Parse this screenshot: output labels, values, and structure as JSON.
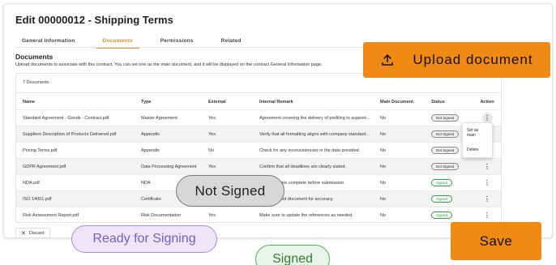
{
  "page": {
    "title": "Edit 00000012 - Shipping Terms",
    "tabs": [
      "General Information",
      "Documents",
      "Permissions",
      "Related"
    ],
    "active_tab": "Documents"
  },
  "documents": {
    "heading": "Documents",
    "description": "Upload documents to associate with this contract. You can set one as the main document, and it will be displayed on the contract General Information page.",
    "count_label": "7 Documents",
    "columns": [
      "Name",
      "Type",
      "External",
      "Internal Remark",
      "Main Document",
      "Status",
      "Action"
    ],
    "rows": [
      {
        "name": "Standard Agreement - Goods - Contract.pdf",
        "type": "Master Agreement",
        "external": "Yes",
        "remark": "Agreement covering the delivery of profiling to support...",
        "main": "No",
        "status": "Not Signed"
      },
      {
        "name": "Suppliers Description of Products Delivered.pdf",
        "type": "Appendix",
        "external": "Yes",
        "remark": "Verify that all formatting aligns with company standard...",
        "main": "No",
        "status": "Not Signed"
      },
      {
        "name": "Pricing Terms.pdf",
        "type": "Appendix",
        "external": "No",
        "remark": "Check for any inconsistencies in the data provided.",
        "main": "No",
        "status": "Not Signed"
      },
      {
        "name": "GDPR Agreement.pdf",
        "type": "Data Processing Agreement",
        "external": "Yes",
        "remark": "Confirm that all deadlines are clearly stated.",
        "main": "No",
        "status": "Not Signed"
      },
      {
        "name": "NDA.pdf",
        "type": "NDA",
        "external": "",
        "remark": "...sections are complete before submission.",
        "main": "No",
        "status": "Signed"
      },
      {
        "name": "ISO 14001.pdf",
        "type": "Certificate",
        "external": "",
        "remark": "...he attached document for accuracy.",
        "main": "No",
        "status": "Signed"
      },
      {
        "name": "Risk Assessment Report.pdf",
        "type": "Risk Documentation",
        "external": "Yes",
        "remark": "Make sure to update the references as needed.",
        "main": "No",
        "status": "Signed"
      }
    ]
  },
  "action_menu": {
    "set_main": "Set as main",
    "delete": "Delete"
  },
  "discard_label": "Discard",
  "upload_label": "Upload document",
  "save_label": "Save",
  "callouts": {
    "not_signed": "Not Signed",
    "ready": "Ready for Signing",
    "signed": "Signed"
  },
  "colors": {
    "accent": "#f08a14",
    "signed": "#2f9e44",
    "ready": "#7a5cc0"
  }
}
